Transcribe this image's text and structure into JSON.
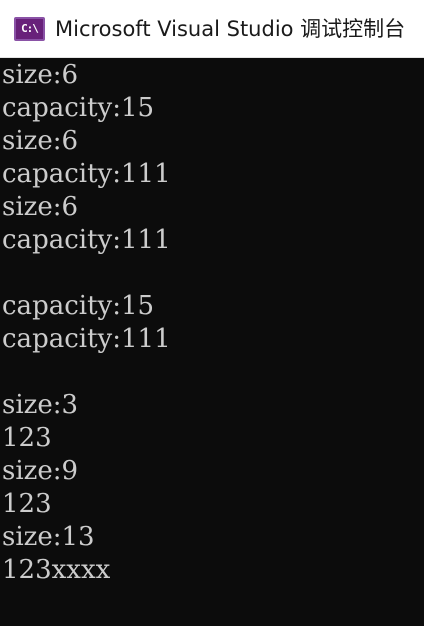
{
  "window": {
    "title": "Microsoft Visual Studio 调试控制台",
    "icon": {
      "name": "visual-studio-console-icon",
      "glyph": "C:\\"
    }
  },
  "console": {
    "lines": [
      "size:6",
      "capacity:15",
      "size:6",
      "capacity:111",
      "size:6",
      "capacity:111",
      "",
      "capacity:15",
      "capacity:111",
      "",
      "size:3",
      "123",
      "size:9",
      "123",
      "size:13",
      "123xxxx"
    ]
  },
  "colors": {
    "console_bg": "#0c0c0c",
    "console_fg": "#cccccc",
    "titlebar_bg": "#ffffff",
    "icon_bg": "#68217a"
  }
}
